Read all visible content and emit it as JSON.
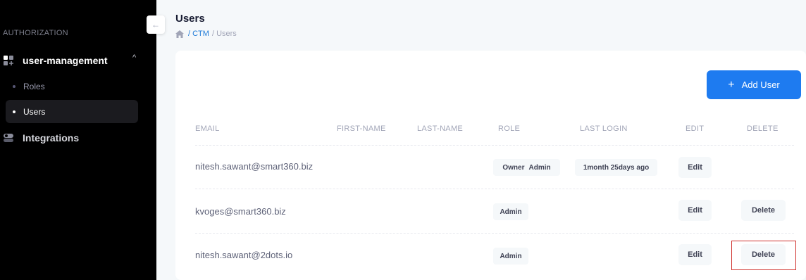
{
  "sidebar": {
    "section_title": "AUTHORIZATION",
    "user_management": {
      "label": "user-management",
      "chevron": "^"
    },
    "items": [
      {
        "label": "Roles"
      },
      {
        "label": "Users"
      }
    ],
    "integrations": {
      "label": "Integrations"
    }
  },
  "collapse_icon": "←",
  "header": {
    "title": "Users",
    "breadcrumb": [
      "/ CTM",
      "/ Users"
    ]
  },
  "toolbar": {
    "add_user_label": "Add User",
    "add_user_icon": "+"
  },
  "table": {
    "columns": [
      "EMAIL",
      "FIRST-NAME",
      "LAST-NAME",
      "ROLE",
      "LAST LOGIN",
      "EDIT",
      "DELETE"
    ],
    "rows": [
      {
        "email": "nitesh.sawant@smart360.biz",
        "first_name": "",
        "last_name": "",
        "roles": [
          "Owner",
          "Admin"
        ],
        "last_login": "1month 25days ago",
        "edit": "Edit",
        "delete": ""
      },
      {
        "email": "kvoges@smart360.biz",
        "first_name": "",
        "last_name": "",
        "roles": [
          "Admin"
        ],
        "last_login": "",
        "edit": "Edit",
        "delete": "Delete"
      },
      {
        "email": "nitesh.sawant@2dots.io",
        "first_name": "",
        "last_name": "",
        "roles": [
          "Admin"
        ],
        "last_login": "",
        "edit": "Edit",
        "delete": "Delete"
      }
    ]
  },
  "colors": {
    "accent": "#1e7bf0",
    "sidebar_bg": "#000000",
    "highlight": "#d0312d",
    "link": "#1e7bd8"
  }
}
